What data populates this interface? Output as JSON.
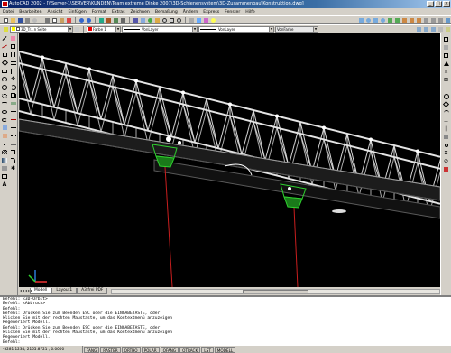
{
  "window": {
    "title": "AutoCAD 2002 - [\\\\Server-1\\SERVER\\KUNDEN\\Team extreme Dinke 2007\\3D-Schienensystem\\3D-Zusammenbau\\Konstruktion.dwg]",
    "min_label": "_",
    "max_label": "□",
    "close_label": "×"
  },
  "menu": [
    "Datei",
    "Bearbeiten",
    "Ansicht",
    "Einfügen",
    "Format",
    "Extras",
    "Zeichnen",
    "Bemaßung",
    "Ändern",
    "Express",
    "Fenster",
    "Hilfe"
  ],
  "toolbar2": {
    "layer_value": "3D_Tr...n Seite",
    "color_value": "Farbe 1",
    "linetype_value": "VonLayer",
    "lineweight_value": "VonLayer",
    "plotstyle_value": "VonFarbe"
  },
  "tabs": [
    "Modell",
    "Layout1",
    "A3 frei PDF"
  ],
  "command_lines": [
    "Befehl: <Abbruch>",
    "Befehl:",
    "Befehl: Drücken Sie zum Beenden ESC oder die EINGABETASTE, oder",
    "klicken Sie mit der rechten Maustaste, um das Kontextmenü anzuzeigen",
    "Regeneriert Modell.",
    "Befehl: Drücken Sie zum Beenden ESC oder die EINGABETASTE, oder",
    "klicken Sie mit der rechten Maustaste, um das Kontextmenü anzuzeigen",
    "Regeneriert Modell.",
    "Befehl:"
  ],
  "command_header": "Befehl: <3D-Orbit>",
  "status": {
    "coords": "-3281.1234, 2165.8721 , 0.0000",
    "buttons": [
      "FANG",
      "RASTER",
      "ORTHO",
      "POLAR",
      "OFANG",
      "OTRACK",
      "LST",
      "MODELL"
    ]
  },
  "colors": {
    "viewport_bg": "#000000",
    "truss": "#c8c8c8",
    "highlight": "#ffffff",
    "connector": "#2fd12f",
    "axis_red": "#c81e1e",
    "title_blue": "#0a246a"
  }
}
